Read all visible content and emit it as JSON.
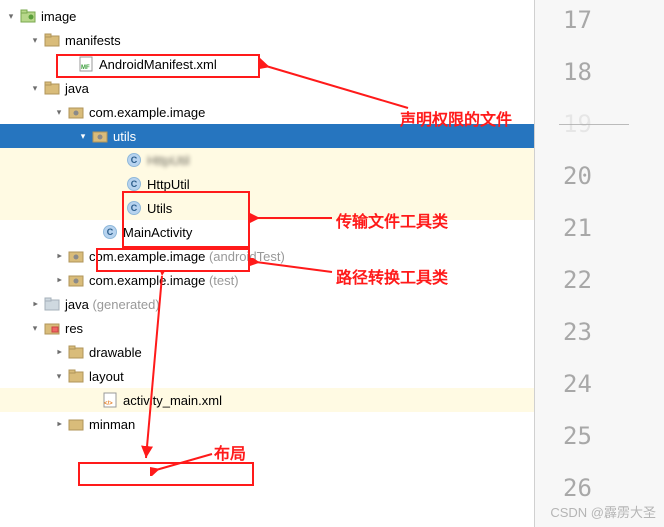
{
  "tree": {
    "root": "image",
    "manifests": {
      "folder": "manifests",
      "file": "AndroidManifest.xml"
    },
    "java": {
      "folder": "java",
      "pkg1": "com.example.image",
      "utils_folder": "utils",
      "blur_class": "HttpUtil",
      "http_util": "HttpUtil",
      "utils_class": "Utils",
      "main_activity": "MainActivity",
      "pkg2_name": "com.example.image",
      "pkg2_suffix": " (androidTest)",
      "pkg3_name": "com.example.image",
      "pkg3_suffix": " (test)"
    },
    "java_gen_name": "java",
    "java_gen_suffix": " (generated)",
    "res": {
      "folder": "res",
      "drawable": "drawable",
      "layout": "layout",
      "activity_main": "activity_main.xml",
      "minman": "minman"
    }
  },
  "annotations": {
    "perm_file": "声明权限的文件",
    "http_tool": "传输文件工具类",
    "path_tool": "路径转换工具类",
    "layout": "布局"
  },
  "line_numbers": [
    "17",
    "18",
    "19",
    "20",
    "21",
    "22",
    "23",
    "24",
    "25",
    "26"
  ],
  "watermark": "CSDN @霹雳大圣"
}
